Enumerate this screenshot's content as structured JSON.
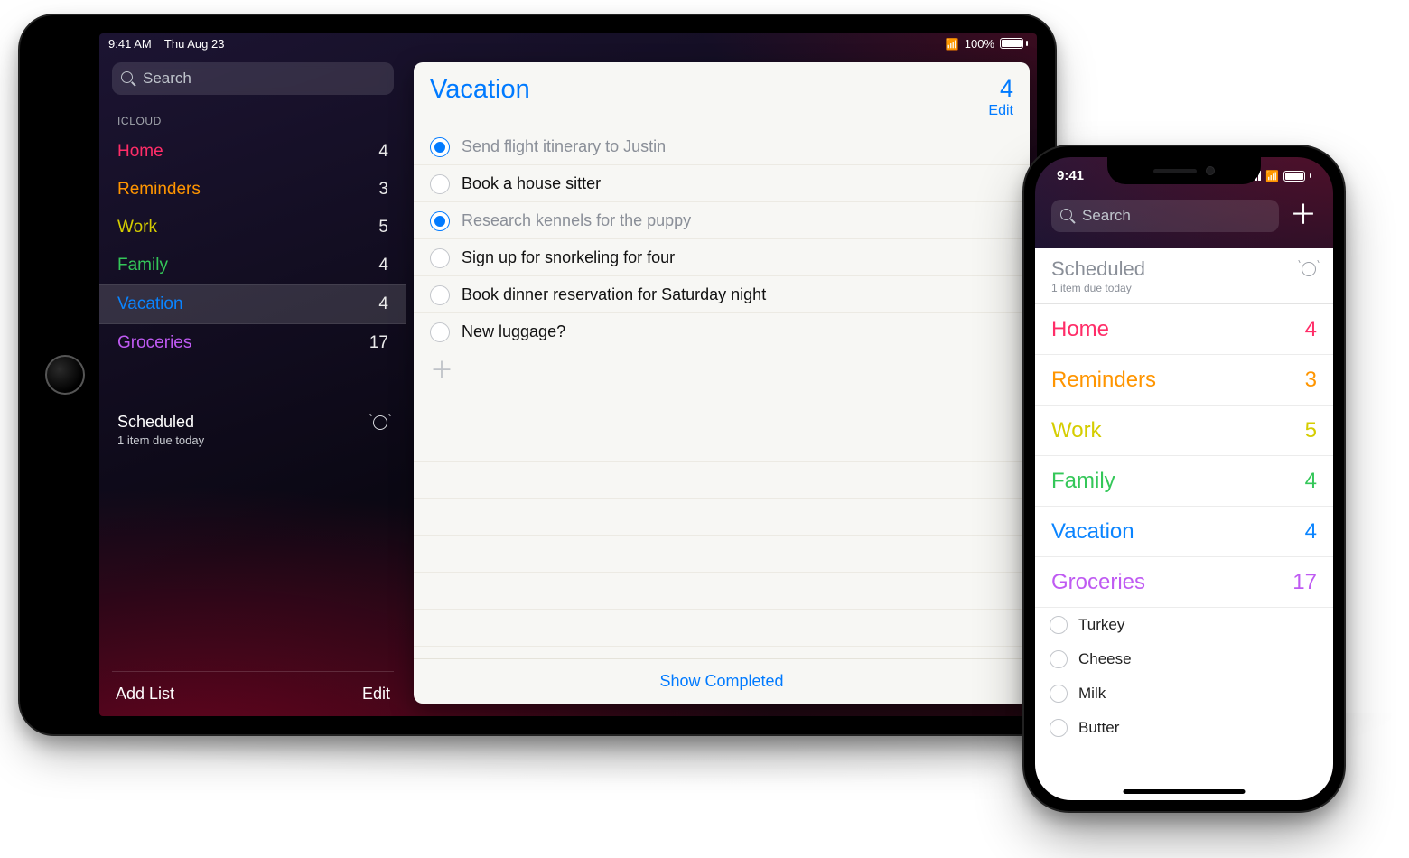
{
  "ipad": {
    "status": {
      "time": "9:41 AM",
      "date": "Thu Aug 23",
      "battery": "100%"
    },
    "search_placeholder": "Search",
    "section_label": "ICLOUD",
    "lists": [
      {
        "name": "Home",
        "count": 4,
        "color": "#ff2d68"
      },
      {
        "name": "Reminders",
        "count": 3,
        "color": "#ff9500"
      },
      {
        "name": "Work",
        "count": 5,
        "color": "#d5cd00"
      },
      {
        "name": "Family",
        "count": 4,
        "color": "#34c759"
      },
      {
        "name": "Vacation",
        "count": 4,
        "color": "#0a84ff",
        "selected": true
      },
      {
        "name": "Groceries",
        "count": 17,
        "color": "#bf5af2"
      }
    ],
    "scheduled": {
      "title": "Scheduled",
      "subtitle": "1 item due today"
    },
    "sidebar_footer": {
      "add_list": "Add List",
      "edit": "Edit"
    },
    "detail": {
      "title": "Vacation",
      "count": 4,
      "edit": "Edit",
      "tasks": [
        {
          "text": "Send flight itinerary to Justin",
          "done": true
        },
        {
          "text": "Book a house sitter",
          "done": false
        },
        {
          "text": "Research kennels for the puppy",
          "done": true
        },
        {
          "text": "Sign up for snorkeling for four",
          "done": false
        },
        {
          "text": "Book dinner reservation for Saturday night",
          "done": false
        },
        {
          "text": "New luggage?",
          "done": false
        }
      ],
      "show_completed": "Show Completed"
    }
  },
  "iphone": {
    "status": {
      "time": "9:41"
    },
    "search_placeholder": "Search",
    "scheduled": {
      "title": "Scheduled",
      "subtitle": "1 item due today"
    },
    "lists": [
      {
        "name": "Home",
        "count": 4,
        "color": "#ff2d68"
      },
      {
        "name": "Reminders",
        "count": 3,
        "color": "#ff9500"
      },
      {
        "name": "Work",
        "count": 5,
        "color": "#d5cd00"
      },
      {
        "name": "Family",
        "count": 4,
        "color": "#34c759"
      },
      {
        "name": "Vacation",
        "count": 4,
        "color": "#0a84ff"
      },
      {
        "name": "Groceries",
        "count": 17,
        "color": "#bf5af2"
      }
    ],
    "grocery_items": [
      "Turkey",
      "Cheese",
      "Milk",
      "Butter"
    ]
  }
}
